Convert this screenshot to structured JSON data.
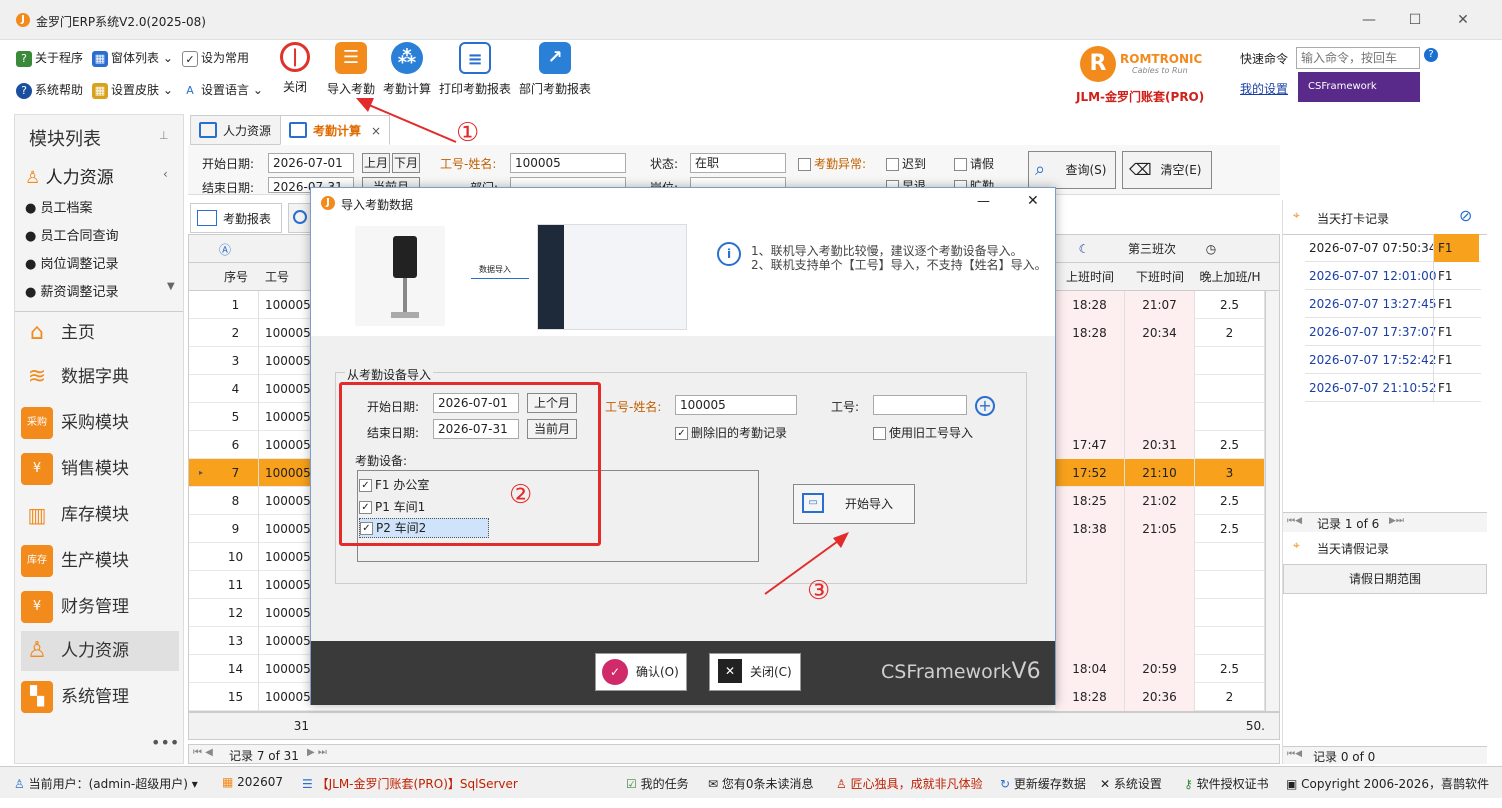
{
  "window": {
    "title": "金罗门ERP系统V2.0(2025-08)"
  },
  "toolbar": {
    "small": [
      {
        "label": "关于程序"
      },
      {
        "label": "窗体列表"
      },
      {
        "label": "设为常用"
      },
      {
        "label": "系统帮助"
      },
      {
        "label": "设置皮肤"
      },
      {
        "label": "设置语言"
      }
    ],
    "big": [
      {
        "label": "关闭"
      },
      {
        "label": "导入考勤"
      },
      {
        "label": "考勤计算"
      },
      {
        "label": "打印考勤报表"
      },
      {
        "label": "部门考勤报表"
      }
    ],
    "brand": "ROMTRONIC",
    "brand_sub": "Cables to Run",
    "account": "JLM-金罗门账套(PRO)",
    "quick_cmd_label": "快速命令",
    "quick_cmd_placeholder": "输入命令，按回车",
    "my_settings": "我的设置",
    "csframework": "CSFramework"
  },
  "left": {
    "header": "模块列表",
    "group": "人力资源",
    "sub_items": [
      "员工档案",
      "员工合同查询",
      "岗位调整记录",
      "薪资调整记录"
    ],
    "modules": [
      "主页",
      "数据字典",
      "采购模块",
      "销售模块",
      "库存模块",
      "生产模块",
      "财务管理",
      "人力资源",
      "系统管理"
    ],
    "module_icons": {
      "purchase": "采购",
      "stock": "库存"
    }
  },
  "tabs": [
    {
      "label": "人力资源"
    },
    {
      "label": "考勤计算"
    }
  ],
  "filters": {
    "start_date_label": "开始日期:",
    "start_date": "2026-07-01",
    "end_date_label": "结束日期:",
    "end_date": "2026-07-31",
    "prev_month": "上月",
    "next_month": "下月",
    "current_month": "当前月",
    "emp_label": "工号-姓名:",
    "emp_value": "100005",
    "dept_label": "部门:",
    "status_label": "状态:",
    "status_value": "在职",
    "post_label": "岗位:",
    "abnormal_label": "考勤异常:",
    "late": "迟到",
    "leave": "请假",
    "early": "早退",
    "absent": "旷勤",
    "query": "查询(S)",
    "clear": "清空(E)"
  },
  "subtabs": [
    {
      "label": "考勤报表"
    }
  ],
  "grid": {
    "col_seq": "序号",
    "col_id": "工号",
    "third_shift": "第三班次",
    "col_on": "上班时间",
    "col_off": "下班时间",
    "col_ot": "晚上加班/H",
    "rows": [
      {
        "seq": "1",
        "id": "100005",
        "on": "18:28",
        "off": "21:07",
        "ot": "2.5"
      },
      {
        "seq": "2",
        "id": "100005",
        "on": "18:28",
        "off": "20:34",
        "ot": "2"
      },
      {
        "seq": "3",
        "id": "100005",
        "on": "",
        "off": "",
        "ot": ""
      },
      {
        "seq": "4",
        "id": "100005",
        "on": "",
        "off": "",
        "ot": ""
      },
      {
        "seq": "5",
        "id": "100005",
        "on": "",
        "off": "",
        "ot": ""
      },
      {
        "seq": "6",
        "id": "100005",
        "on": "17:47",
        "off": "20:31",
        "ot": "2.5"
      },
      {
        "seq": "7",
        "id": "100005",
        "on": "17:52",
        "off": "21:10",
        "ot": "3"
      },
      {
        "seq": "8",
        "id": "100005",
        "on": "18:25",
        "off": "21:02",
        "ot": "2.5"
      },
      {
        "seq": "9",
        "id": "100005",
        "on": "18:38",
        "off": "21:05",
        "ot": "2.5"
      },
      {
        "seq": "10",
        "id": "100005",
        "on": "",
        "off": "",
        "ot": ""
      },
      {
        "seq": "11",
        "id": "100005",
        "on": "",
        "off": "",
        "ot": ""
      },
      {
        "seq": "12",
        "id": "100005",
        "on": "",
        "off": "",
        "ot": ""
      },
      {
        "seq": "13",
        "id": "100005",
        "on": "",
        "off": "",
        "ot": ""
      },
      {
        "seq": "14",
        "id": "100005",
        "on": "18:04",
        "off": "20:59",
        "ot": "2.5"
      },
      {
        "seq": "15",
        "id": "100005",
        "on": "18:28",
        "off": "20:36",
        "ot": "2"
      }
    ],
    "footer_count": "31",
    "footer_total": "50.",
    "nav": "记录 7 of 31"
  },
  "right": {
    "punch_title": "当天打卡记录",
    "punches": [
      {
        "time": "2026-07-07 07:50:34",
        "dev": "F1"
      },
      {
        "time": "2026-07-07 12:01:00",
        "dev": "F1"
      },
      {
        "time": "2026-07-07 13:27:45",
        "dev": "F1"
      },
      {
        "time": "2026-07-07 17:37:07",
        "dev": "F1"
      },
      {
        "time": "2026-07-07 17:52:42",
        "dev": "F1"
      },
      {
        "time": "2026-07-07 21:10:52",
        "dev": "F1"
      }
    ],
    "punch_nav": "记录 1 of 6",
    "leave_title": "当天请假记录",
    "leave_col": "请假日期范围",
    "leave_nav": "记录 0 of 0"
  },
  "dialog": {
    "title": "导入考勤数据",
    "import_label": "数据导入",
    "info1": "1、联机导入考勤比较慢，建议逐个考勤设备导入。",
    "info2": "2、联机支持单个【工号】导入，不支持【姓名】导入。",
    "group_title": "从考勤设备导入",
    "start_label": "开始日期:",
    "start": "2026-07-01",
    "prev_month": "上个月",
    "end_label": "结束日期:",
    "end": "2026-07-31",
    "cur_month": "当前月",
    "emp_label": "工号-姓名:",
    "emp_value": "100005",
    "delete_old": "删除旧的考勤记录",
    "id_label": "工号:",
    "use_old_id": "使用旧工号导入",
    "devices_label": "考勤设备:",
    "devices": [
      "F1 办公室",
      "P1 车间1",
      "P2 车间2"
    ],
    "start_import": "开始导入",
    "ok": "确认(O)",
    "close": "关闭(C)",
    "brand": "CSFramework",
    "brand_ver": "V6"
  },
  "annotations": {
    "one": "①",
    "two": "②",
    "three": "③"
  },
  "status": {
    "user": "当前用户：(admin-超级用户)",
    "period": "202607",
    "db": "【JLM-金罗门账套(PRO)】SqlServer",
    "tasks": "我的任务",
    "msgs": "您有0条未读消息",
    "slogan": "匠心独具，成就非凡体验",
    "refresh": "更新缓存数据",
    "settings": "系统设置",
    "license": "软件授权证书",
    "copyright": "Copyright 2006-2026，喜鹊软件"
  },
  "colors": {
    "accent": "#f28a1c",
    "selected_row": "#f7a11c",
    "annotation": "#e32b2b",
    "link": "#1a3fa6"
  }
}
